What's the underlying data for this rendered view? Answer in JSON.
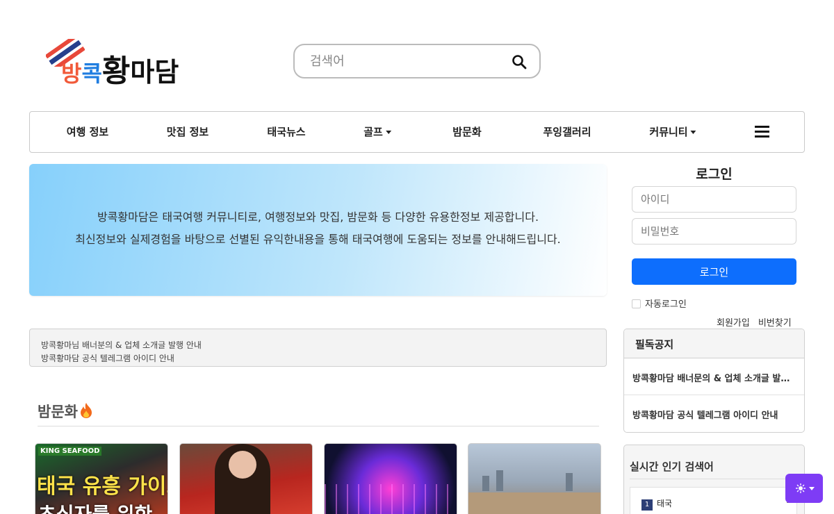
{
  "header": {
    "logo_parts": [
      "방",
      "콕",
      "황",
      "마담"
    ],
    "search_placeholder": "검색어"
  },
  "nav": {
    "items": [
      {
        "label": "여행 정보",
        "dropdown": false
      },
      {
        "label": "맛집 정보",
        "dropdown": false
      },
      {
        "label": "태국뉴스",
        "dropdown": false
      },
      {
        "label": "골프",
        "dropdown": true
      },
      {
        "label": "밤문화",
        "dropdown": false
      },
      {
        "label": "푸잉갤러리",
        "dropdown": false
      },
      {
        "label": "커뮤니티",
        "dropdown": true
      }
    ],
    "menu_icon": "hamburger-icon"
  },
  "banner": {
    "line1": "방콕황마담은 태국여행 커뮤니티로, 여행정보와 맛집, 밤문화 등 다양한 유용한정보 제공합니다.",
    "line2": "최신정보와 실제경험을 바탕으로 선별된 유익한내용을 통해 태국여행에 도움되는 정보를 안내해드립니다."
  },
  "ticker": {
    "items": [
      "방콕황마님 배너분의 & 업체 소개글 발행 안내",
      "방콕황마담 공식 텔레그램 아이디 안내"
    ]
  },
  "section": {
    "title": "밤문화",
    "title_icon": "fire-icon",
    "thumb1_tag": "KING SEAFOOD",
    "thumb1_text": "태국 유흥 가이드",
    "thumb1_text2": "초심자를 위한"
  },
  "login": {
    "title": "로그인",
    "id_placeholder": "아이디",
    "pw_placeholder": "비밀번호",
    "button": "로그인",
    "auto_login": "자동로그인",
    "signup": "회원가입",
    "find_pw": "비번찾기"
  },
  "notices": {
    "title": "필독공지",
    "items": [
      "방콕황마담 배너문의 & 업체 소개글 발행 안내",
      "방콕황마담 공식 텔레그램 아이디 안내"
    ]
  },
  "popular": {
    "title": "실시간 인기 검색어",
    "items": [
      {
        "rank": "1",
        "term": "태국"
      }
    ]
  },
  "colors": {
    "accent": "#0d6efd",
    "theme_toggle": "#7e3cf5",
    "logo_orange": "#f15a3a",
    "logo_blue": "#1f7de0"
  }
}
